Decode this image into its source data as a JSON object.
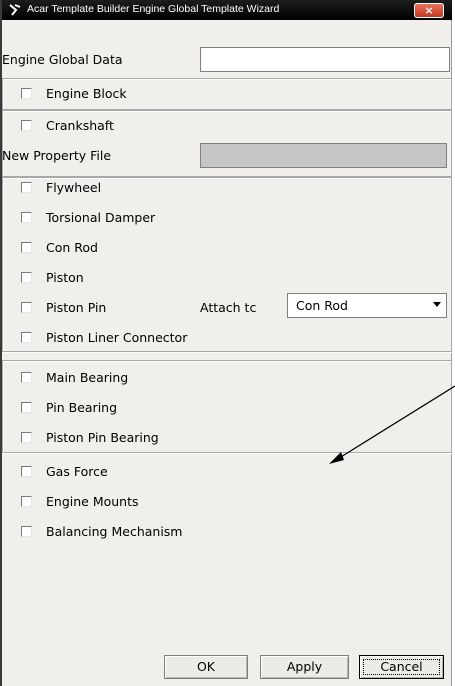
{
  "window": {
    "title": "Acar Template Builder Engine Global Template Wizard",
    "close_symbol": "×",
    "title_icon": "acar-logo-icon"
  },
  "form": {
    "engine_global_data_label": "Engine Global Data",
    "engine_global_data_value": "",
    "new_property_file_label": "New Property File",
    "new_property_file_value": "",
    "attach_to_label": "Attach tc",
    "attach_to_value": "Con Rod"
  },
  "checkboxes": {
    "engine_block": {
      "label": "Engine Block",
      "checked": false
    },
    "crankshaft": {
      "label": "Crankshaft",
      "checked": false
    },
    "flywheel": {
      "label": "Flywheel",
      "checked": false
    },
    "torsional_damper": {
      "label": "Torsional Damper",
      "checked": false
    },
    "con_rod": {
      "label": "Con Rod",
      "checked": false
    },
    "piston": {
      "label": "Piston",
      "checked": false
    },
    "piston_pin": {
      "label": "Piston Pin",
      "checked": false
    },
    "piston_liner_connector": {
      "label": "Piston Liner Connector",
      "checked": false
    },
    "main_bearing": {
      "label": "Main Bearing",
      "checked": false
    },
    "pin_bearing": {
      "label": "Pin Bearing",
      "checked": false
    },
    "piston_pin_bearing": {
      "label": "Piston Pin Bearing",
      "checked": false
    },
    "gas_force": {
      "label": "Gas Force",
      "checked": false
    },
    "engine_mounts": {
      "label": "Engine Mounts",
      "checked": false
    },
    "balancing_mechanism": {
      "label": "Balancing Mechanism",
      "checked": false
    }
  },
  "buttons": {
    "ok": "OK",
    "apply": "Apply",
    "cancel": "Cancel"
  },
  "colors": {
    "dialog_bg": "#f0efec",
    "titlebar": "#000000",
    "close_button": "#d04a2e",
    "annotation_arrow": "#000000"
  }
}
